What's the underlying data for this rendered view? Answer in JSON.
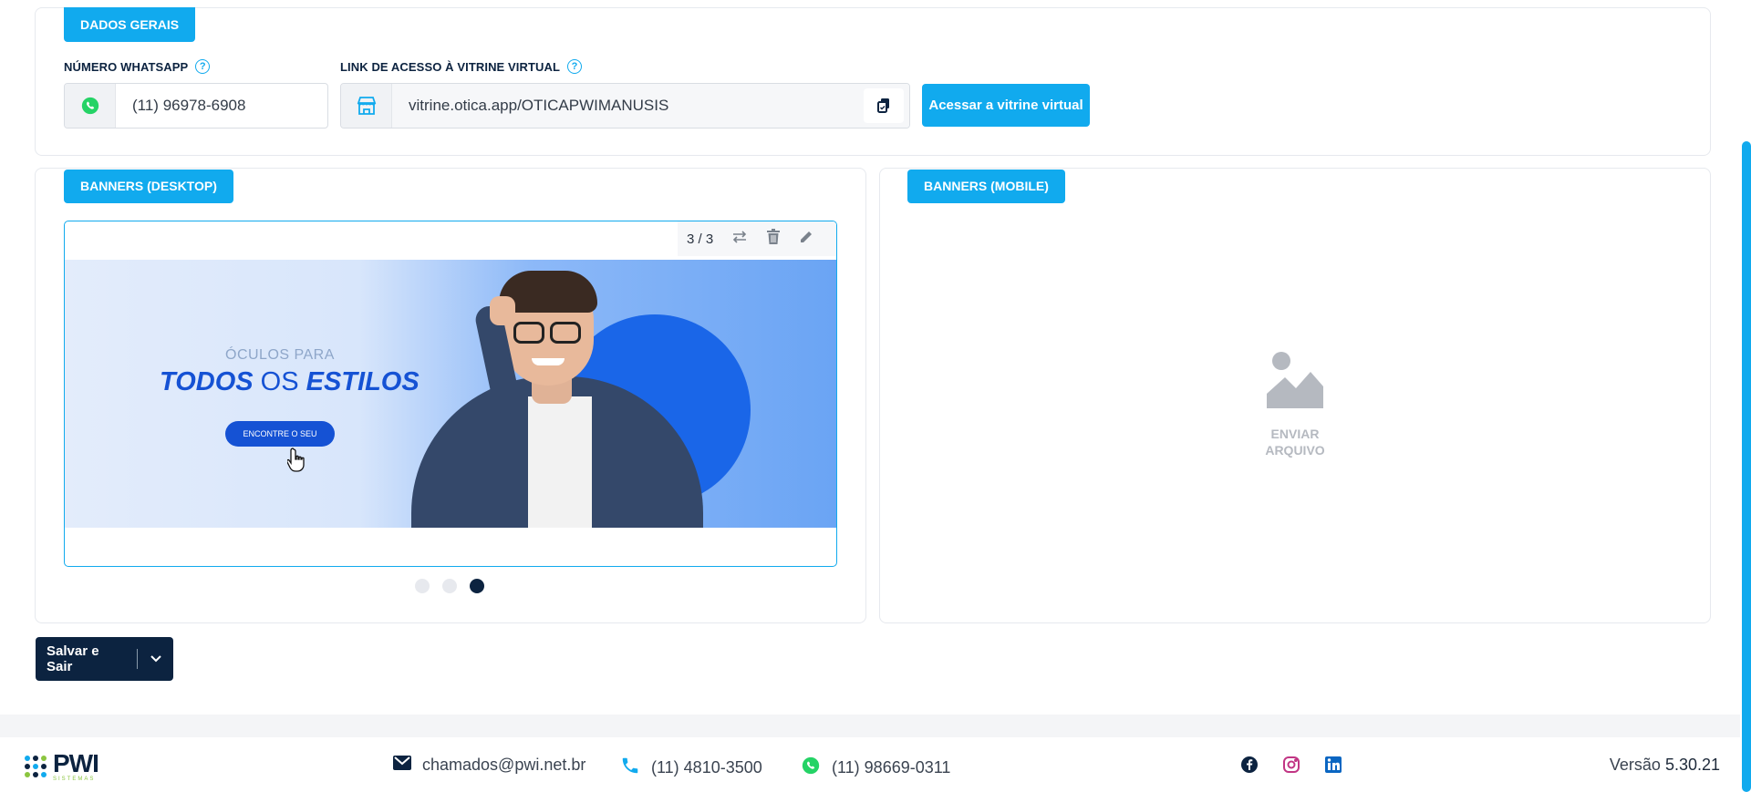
{
  "dados_gerais": {
    "tag": "DADOS GERAIS",
    "whatsapp_label": "NÚMERO WHATSAPP",
    "whatsapp_value": "(11) 96978-6908",
    "link_label": "LINK DE ACESSO À VITRINE VIRTUAL",
    "link_value": "vitrine.otica.app/OTICAPWIMANUSIS",
    "access_button": "Acessar a vitrine virtual",
    "help_glyph": "?"
  },
  "banners_desktop": {
    "tag": "BANNERS (DESKTOP)",
    "counter": "3 / 3",
    "image": {
      "line1": "ÓCULOS PARA",
      "line2_bold1": "TODOS",
      "line2_mid": "OS",
      "line2_bold2": "ESTILOS",
      "cta": "ENCONTRE O SEU"
    },
    "slides_total": 3,
    "slide_active": 3
  },
  "banners_mobile": {
    "tag": "BANNERS (MOBILE)",
    "upload_line1": "ENVIAR",
    "upload_line2": "ARQUIVO"
  },
  "actions": {
    "save_label": "Salvar e Sair"
  },
  "footer": {
    "logo_text": "PWI",
    "logo_sub": "SISTEMAS",
    "email": "chamados@pwi.net.br",
    "phone": "(11) 4810-3500",
    "whatsapp": "(11) 98669-0311",
    "version_label": "Versão",
    "version_number": "5.30.21"
  },
  "colors": {
    "accent": "#11aaee",
    "navy": "#0c2340",
    "whatsapp_green": "#25d366",
    "facebook": "#0c2340",
    "instagram": "#c13584",
    "linkedin": "#0a66c2"
  },
  "icons": [
    "whatsapp-icon",
    "store-icon",
    "copy-icon",
    "help-icon",
    "swap-icon",
    "trash-icon",
    "edit-icon",
    "image-placeholder-icon",
    "chevron-down-icon",
    "mail-icon",
    "phone-icon",
    "facebook-icon",
    "instagram-icon",
    "linkedin-icon"
  ]
}
